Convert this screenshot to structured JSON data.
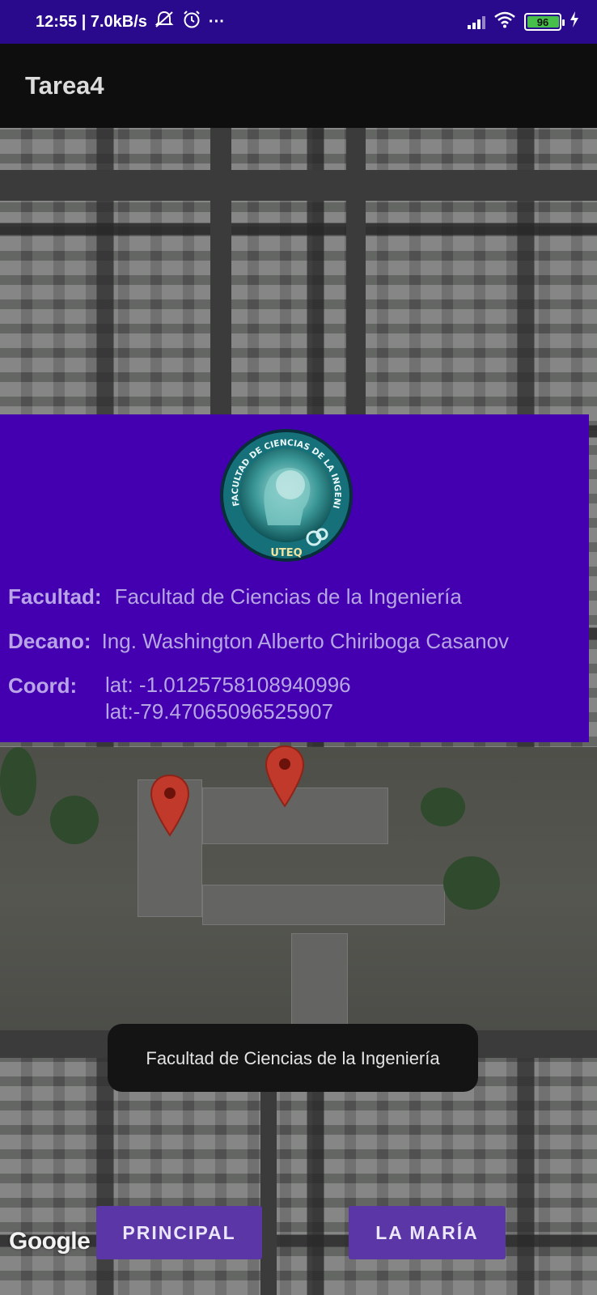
{
  "status_bar": {
    "time_speed": "12:55 | 7.0kB/s",
    "more": "···",
    "battery_level": "96",
    "icons": [
      "mute-icon",
      "alarm-icon",
      "signal-icon",
      "wifi-icon",
      "battery-icon",
      "charging-icon"
    ]
  },
  "app_bar": {
    "title": "Tarea4"
  },
  "info": {
    "logo": {
      "ring_text": "FACULTAD DE CIENCIAS DE LA INGENIERÍA",
      "badge": "UTEQ"
    },
    "facultad_label": "Facultad:",
    "facultad_value": "Facultad de Ciencias de la Ingeniería",
    "decano_label": "Decano:",
    "decano_value": "Ing. Washington Alberto Chiriboga Casanov",
    "coord_label": "Coord:",
    "coord_lat": "lat: -1.0125758108940996",
    "coord_lng": "lat:-79.47065096525907"
  },
  "toast": {
    "text": "Facultad de Ciencias de la Ingeniería"
  },
  "buttons": {
    "principal": "PRINCIPAL",
    "la_maria": "LA MARÍA"
  },
  "map": {
    "attribution": "Google"
  },
  "colors": {
    "status_bar": "#2a0a8c",
    "app_bar": "#0e0e0e",
    "card": "#4400b0",
    "button": "#5b36a6",
    "marker": "#c0392b"
  }
}
